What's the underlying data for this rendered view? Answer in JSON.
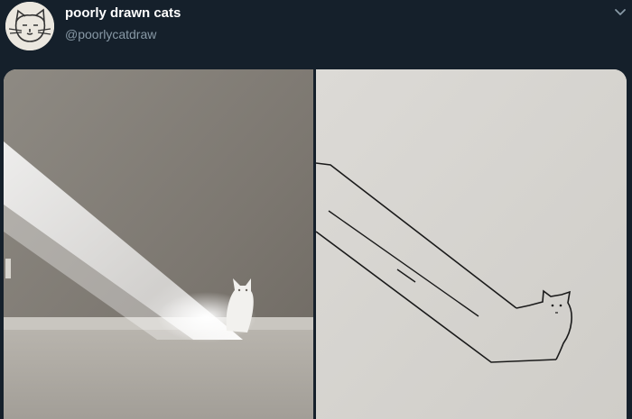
{
  "tweet": {
    "author": {
      "display_name": "poorly drawn cats",
      "handle": "@poorlycatdraw"
    },
    "media": {
      "left_panel": "photo of a white cat sitting in a beam of sunlight",
      "right_panel": "line drawing of a cat with a long stretched body"
    }
  },
  "icons": {
    "avatar": "cat-face-sketch",
    "caret": "chevron-down-icon"
  },
  "colors": {
    "background": "#15202b",
    "name": "#ffffff",
    "handle": "#8899a6"
  }
}
